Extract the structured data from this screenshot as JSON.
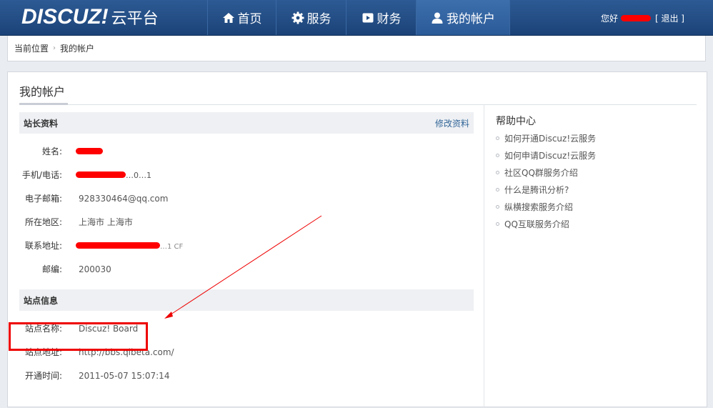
{
  "header": {
    "logo_main": "DISCUZ!",
    "logo_sub": "云平台",
    "nav": [
      {
        "label": "首页",
        "icon": "home-icon",
        "active": false
      },
      {
        "label": "服务",
        "icon": "gear-icon",
        "active": false
      },
      {
        "label": "财务",
        "icon": "finance-icon",
        "active": false
      },
      {
        "label": "我的帐户",
        "icon": "user-icon",
        "active": true
      }
    ],
    "greeting": "您好",
    "logout_label": "[ 退出 ]"
  },
  "breadcrumb": {
    "current": "当前位置",
    "page": "我的帐户"
  },
  "page_title": "我的帐户",
  "webmaster": {
    "title": "站长资料",
    "edit_label": "修改资料",
    "fields": [
      {
        "label": "姓名:",
        "value": ""
      },
      {
        "label": "手机/电话:",
        "value": "…0…1"
      },
      {
        "label": "电子邮箱:",
        "value": "928330464@qq.com"
      },
      {
        "label": "所在地区:",
        "value": "上海市 上海市"
      },
      {
        "label": "联系地址:",
        "value": "…1 CF"
      },
      {
        "label": "邮编:",
        "value": "200030"
      }
    ]
  },
  "site": {
    "title": "站点信息",
    "fields": [
      {
        "label": "站点名称:",
        "value": "Discuz! Board"
      },
      {
        "label": "站点地址:",
        "value": "http://bbs.qlbeta.com/"
      },
      {
        "label": "开通时间:",
        "value": "2011-05-07 15:07:14"
      }
    ]
  },
  "help": {
    "title": "帮助中心",
    "items": [
      "如何开通Discuz!云服务",
      "如何申请Discuz!云服务",
      "社区QQ群服务介绍",
      "什么是腾讯分析?",
      "纵横搜索服务介绍",
      "QQ互联服务介绍"
    ]
  },
  "colors": {
    "header_bg": "#1f4a82",
    "annotation": "#e00000"
  }
}
